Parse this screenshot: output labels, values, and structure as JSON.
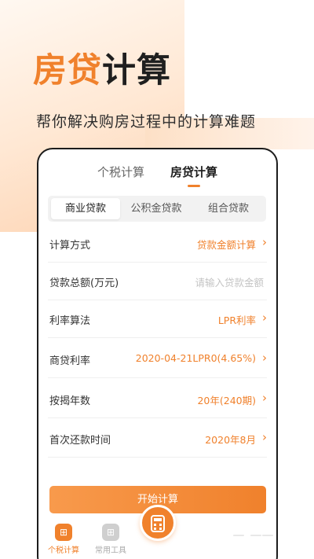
{
  "headline": {
    "accent": "房贷",
    "rest": "计算"
  },
  "subline": "帮你解决购房过程中的计算难题",
  "top_tabs": [
    {
      "label": "个税计算",
      "active": false
    },
    {
      "label": "房贷计算",
      "active": true
    }
  ],
  "loan_types": [
    {
      "label": "商业贷款",
      "active": true
    },
    {
      "label": "公积金贷款",
      "active": false
    },
    {
      "label": "组合贷款",
      "active": false
    }
  ],
  "form": {
    "calc_method": {
      "label": "计算方式",
      "value": "贷款金额计算"
    },
    "loan_total": {
      "label": "贷款总额(万元)",
      "placeholder": "请输入贷款金额"
    },
    "rate_method": {
      "label": "利率算法",
      "value": "LPR利率"
    },
    "commercial_rate": {
      "label": "商贷利率",
      "value": "2020-04-21LPR0(4.65%)"
    },
    "years": {
      "label": "按揭年数",
      "value": "20年(240期)"
    },
    "first_repay": {
      "label": "首次还款时间",
      "value": "2020年8月"
    }
  },
  "start_button": "开始计算",
  "bottom_nav": [
    {
      "label": "个税计算",
      "icon": "calculator-icon",
      "active": true
    },
    {
      "label": "常用工具",
      "icon": "tools-grid-icon",
      "active": false
    },
    {
      "label": "",
      "icon": "calculator-fab-icon",
      "active": false
    }
  ],
  "colors": {
    "accent": "#f0812c",
    "text_dark": "#1f1f1f",
    "placeholder": "#c4c4c4"
  }
}
